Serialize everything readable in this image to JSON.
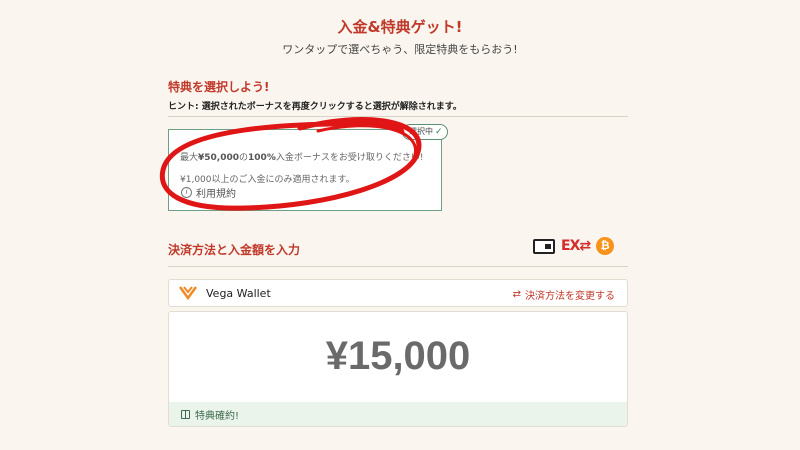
{
  "header": {
    "title": "入金&特典ゲット!",
    "subtitle": "ワンタップで選べちゃう、限定特典をもらおう!"
  },
  "bonus_section": {
    "heading": "特典を選択しよう!",
    "hint": "ヒント: 選択されたボーナスを再度クリックすると選択が解除されます。",
    "card": {
      "badge": "選択中",
      "desc_prefix": "最大",
      "desc_amount": "¥50,000",
      "desc_mid": "の",
      "desc_percent": "100%",
      "desc_suffix": "入金ボーナスをお受け取りください!",
      "condition": "¥1,000以上のご入金にのみ適用されます。",
      "terms_link": "利用規約",
      "info_icon": "info-icon"
    },
    "annotation_color": "#e01515"
  },
  "payment_section": {
    "heading": "決済方法と入金額を入力",
    "icons": [
      "wallet-icon",
      "ex-exchange-icon",
      "bitcoin-icon"
    ],
    "wallet": {
      "name": "Vega Wallet",
      "change_label": "決済方法を変更する"
    },
    "amount": "¥15,000",
    "bonus_confirmed": "特典確約!"
  },
  "colors": {
    "accent": "#c0392b",
    "background": "#faf6ef",
    "selected_border": "#6e9e86",
    "confirm_bg": "#eaf4ea",
    "bitcoin": "#f7931a"
  }
}
